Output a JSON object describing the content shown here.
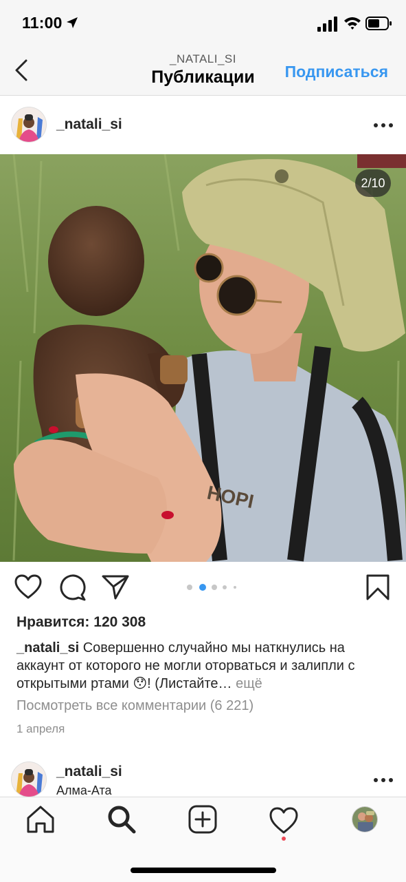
{
  "status_bar": {
    "time": "11:00"
  },
  "nav": {
    "username": "_NATALI_SI",
    "title": "Публикации",
    "follow_label": "Подписаться"
  },
  "post": {
    "username": "_natali_si",
    "carousel_counter": "2/10",
    "carousel_index": 2,
    "carousel_total": 10,
    "likes_text": "Нравится: 120 308",
    "caption_user": "_natali_si",
    "caption_text": " Совершенно случайно мы наткнулись на аккаунт от которого не могли оторваться и залипли с открытыми ртами 😯! (Листайте… ",
    "caption_more": "ещё",
    "view_comments": "Посмотреть все комментарии (6 221)",
    "date": "1 апреля"
  },
  "next_post": {
    "username": "_natali_si",
    "location": "Алма-Ата"
  },
  "tab_bar": {
    "items": [
      "home-icon",
      "search-icon",
      "add-post-icon",
      "activity-heart-icon",
      "profile-avatar"
    ],
    "active": "search-icon",
    "activity_badge": true
  },
  "colors": {
    "accent": "#3897f0",
    "badge": "#ed4956",
    "muted": "#8e8e8e"
  }
}
